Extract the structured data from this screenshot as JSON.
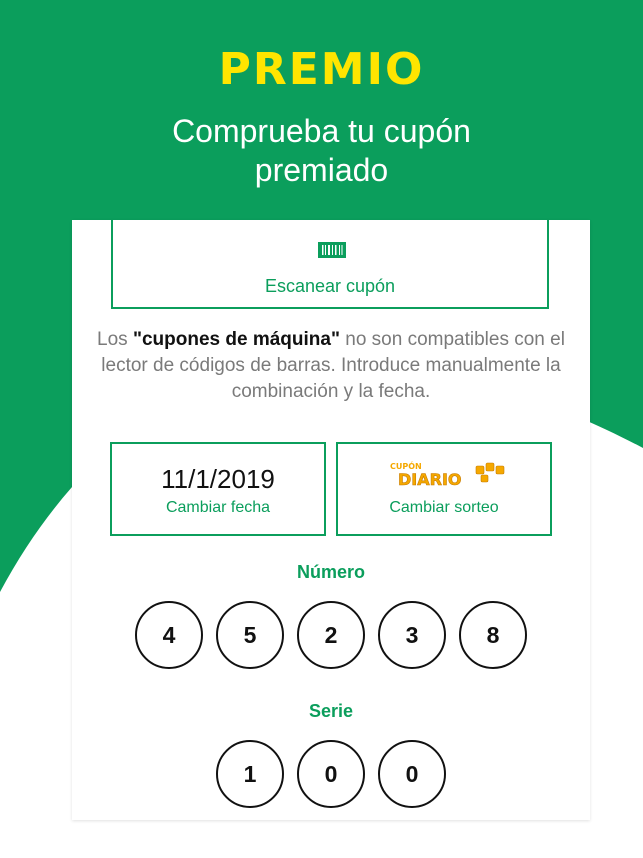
{
  "hero": {
    "title": "PREMIO",
    "subtitle_line1": "Comprueba tu cupón",
    "subtitle_line2": "premiado"
  },
  "scan": {
    "icon": "barcode-icon",
    "label": "Escanear cupón"
  },
  "info": {
    "prefix": "Los ",
    "bold": "\"cupones de máquina\"",
    "suffix": " no son compatibles con el lector de códigos de barras. Introduce manualmente la combinación y la fecha."
  },
  "date_box": {
    "value": "11/1/2019",
    "label": "Cambiar fecha"
  },
  "draw_box": {
    "logo_text_top": "CUPÓN",
    "logo_text_main": "DIARIO",
    "label": "Cambiar sorteo"
  },
  "numero": {
    "title": "Número",
    "digits": [
      "4",
      "5",
      "2",
      "3",
      "8"
    ]
  },
  "serie": {
    "title": "Serie",
    "digits": [
      "1",
      "0",
      "0"
    ]
  },
  "colors": {
    "green": "#0b9e5c",
    "yellow": "#ffe500",
    "logo_orange": "#f5a800"
  }
}
